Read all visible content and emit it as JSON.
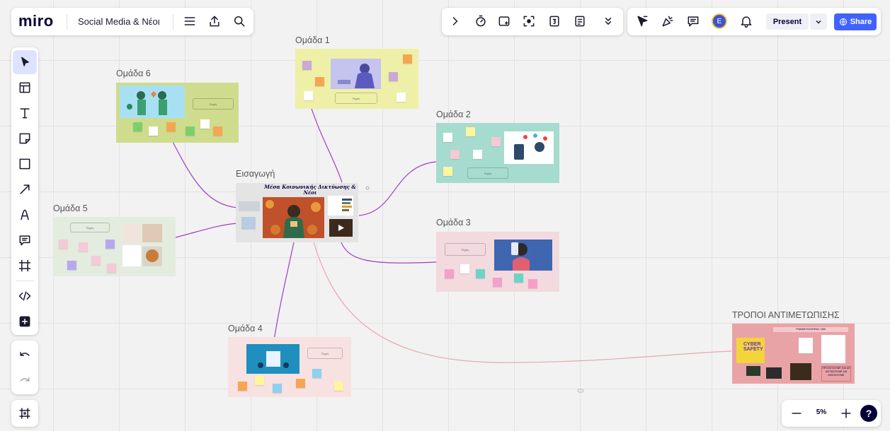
{
  "app": {
    "logo": "miro",
    "board_title": "Social Media & Νέοι"
  },
  "top_toolbar": {
    "icons": [
      "chevron-right-icon",
      "timer-icon",
      "card-icon",
      "focus-icon",
      "counter-icon",
      "notes-icon",
      "more-icon"
    ]
  },
  "right_toolbar": {
    "present_label": "Present",
    "share_label": "Share",
    "avatar_letter": "E"
  },
  "frames": {
    "intro": {
      "label": "Εισαγωγή",
      "title": "Μέσα Κοινωνικής Δικτύωσης & Νέοι"
    },
    "g1": {
      "label": "Ομάδα 1",
      "box": "Πηγές"
    },
    "g2": {
      "label": "Ομάδα 2",
      "box": "Πηγές"
    },
    "g3": {
      "label": "Ομάδα 3",
      "box": "Πηγές"
    },
    "g4": {
      "label": "Ομάδα 4",
      "box": "Πηγές"
    },
    "g5": {
      "label": "Ομάδα 5",
      "box": "Πηγές"
    },
    "g6": {
      "label": "Ομάδα 6",
      "box": "Πηγές"
    },
    "tropoi": {
      "label": "ΤΡΟΠΟΙ ΑΝΤΙΜΕΤΩΠΙΣΗΣ",
      "header": "ΓΡΑΜΜΗ ΒΟΗΘΕΙΑΣ 1480",
      "cyber": "CYBER SAFETY",
      "note": "ΠΡΟΣΕΧΟΥΜΕ ΚΑΙ ΔΕ ΔΙΣΤΑΖΟΥΜΕ ΝΑ ΜΙΛΗΣΟΥΜΕ"
    }
  },
  "zoom": {
    "level": "5%"
  },
  "colors": {
    "share": "#4262ff",
    "g1": "#eef0a7",
    "g2": "#a6dccf",
    "g3": "#f2dadf",
    "g4": "#f7e2e1",
    "g5": "#e3ecdf",
    "g6": "#cfdc8d",
    "tropoi": "#e8a3a6",
    "connector": "#9c3fc0"
  }
}
